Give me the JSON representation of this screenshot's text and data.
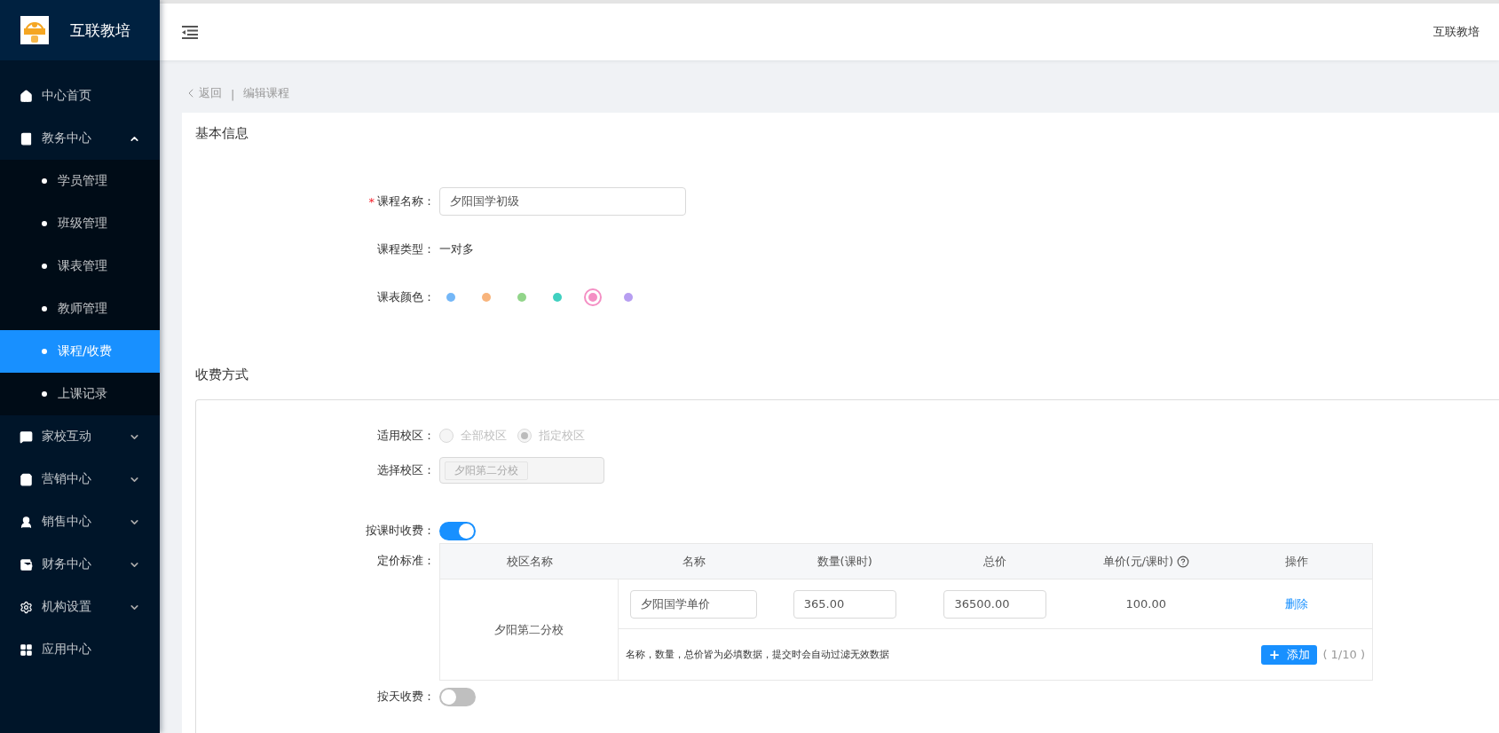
{
  "sidebar": {
    "brand": "互联教培",
    "menu": [
      {
        "label": "中心首页",
        "selected": false
      },
      {
        "label": "教务中心",
        "selected": false,
        "expanded": true,
        "children": [
          {
            "label": "学员管理",
            "selected": false
          },
          {
            "label": "班级管理",
            "selected": false
          },
          {
            "label": "课表管理",
            "selected": false
          },
          {
            "label": "教师管理",
            "selected": false
          },
          {
            "label": "课程/收费",
            "selected": true
          },
          {
            "label": "上课记录",
            "selected": false
          }
        ]
      },
      {
        "label": "家校互动",
        "selected": false,
        "expanded": false
      },
      {
        "label": "营销中心",
        "selected": false,
        "expanded": false
      },
      {
        "label": "销售中心",
        "selected": false,
        "expanded": false
      },
      {
        "label": "财务中心",
        "selected": false,
        "expanded": false
      },
      {
        "label": "机构设置",
        "selected": false,
        "expanded": false
      },
      {
        "label": "应用中心",
        "selected": false
      }
    ]
  },
  "header": {
    "user": "互联教培"
  },
  "breadcrumb": {
    "back": "返回",
    "separator": "|",
    "current": "编辑课程"
  },
  "basic_info": {
    "title": "基本信息",
    "name": {
      "label": "课程名称：",
      "required_mark": "*",
      "value": "夕阳国学初级"
    },
    "type": {
      "label": "课程类型：",
      "value": "一对多"
    },
    "color": {
      "label": "课表颜色：",
      "options": [
        {
          "color": "#74b7f7",
          "selected": false
        },
        {
          "color": "#f8b47c",
          "selected": false
        },
        {
          "color": "#92d58a",
          "selected": false
        },
        {
          "color": "#40d0c0",
          "selected": false
        },
        {
          "color": "#f48fc4",
          "selected": true
        },
        {
          "color": "#b79ef1",
          "selected": false
        }
      ]
    }
  },
  "fee": {
    "title": "收费方式",
    "campus_scope": {
      "label": "适用校区：",
      "disabled": true,
      "options": [
        {
          "label": "全部校区",
          "selected": false
        },
        {
          "label": "指定校区",
          "selected": true
        }
      ]
    },
    "campus_select": {
      "label": "选择校区：",
      "tags": [
        "夕阳第二分校"
      ]
    },
    "by_hour": {
      "label": "按课时收费：",
      "on": true
    },
    "pricing": {
      "label": "定价标准：",
      "columns": [
        "校区名称",
        "名称",
        "数量(课时)",
        "总价",
        "单价(元/课时)",
        "操作"
      ],
      "groups": [
        {
          "campus": "夕阳第二分校",
          "rows": [
            {
              "name": "夕阳国学单价",
              "quantity": "365.00",
              "total": "36500.00",
              "unit_price": "100.00",
              "action": "删除"
            }
          ],
          "hint": "名称，数量，总价皆为必填数据，提交时会自动过滤无效数据",
          "add": "添加",
          "count": "( 1/10 )"
        }
      ]
    },
    "by_day": {
      "label": "按天收费：",
      "on": false
    }
  }
}
